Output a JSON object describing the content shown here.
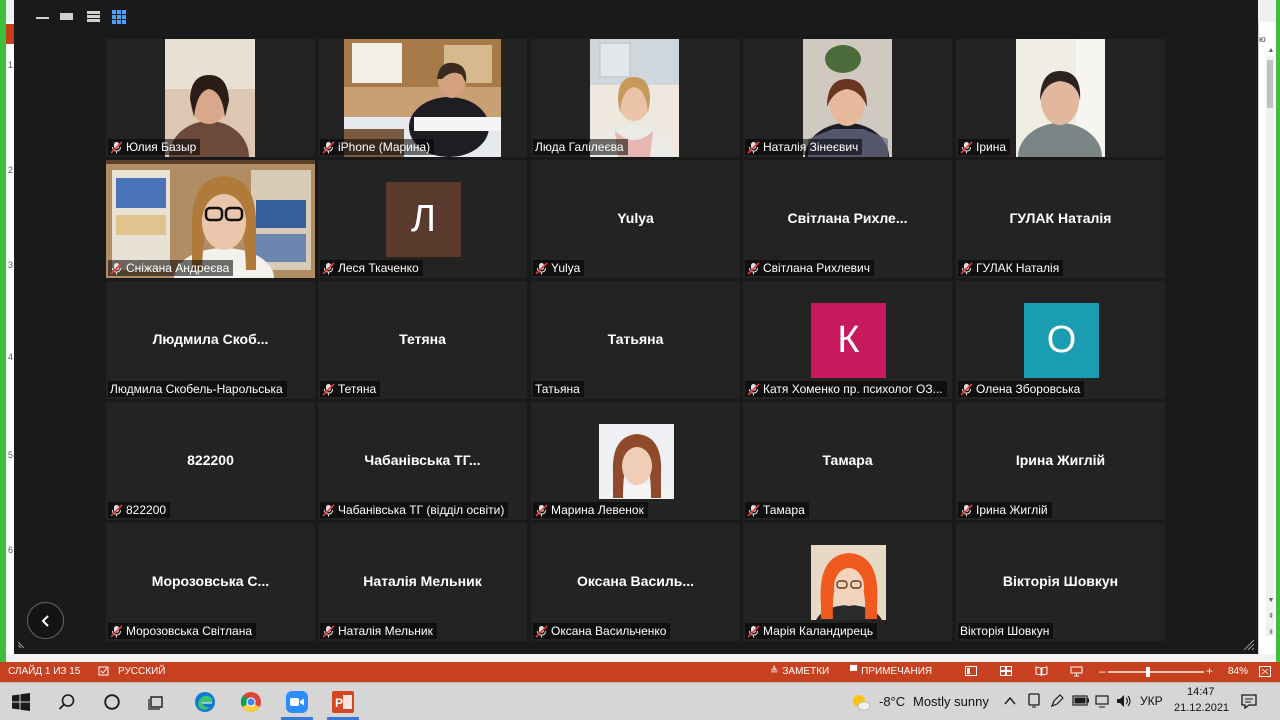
{
  "ppt": {
    "slide_numbers": [
      "1",
      "2",
      "3",
      "4",
      "5",
      "6"
    ],
    "right_edge_text": "ю",
    "status": {
      "slide_label": "СЛАЙД 1 ИЗ 15",
      "language": "РУССКИЙ",
      "notes": "ЗАМЕТКИ",
      "comments": "ПРИМЕЧАНИЯ",
      "zoom_minus": "–",
      "zoom_plus": "+",
      "zoom_level": "84%",
      "zoom_fraction": 0.4
    }
  },
  "zoom": {
    "grid": [
      {
        "name": "Юлия Базыр",
        "center": "",
        "muted": true,
        "kind": "photo",
        "photo": "woman-bob-dark"
      },
      {
        "name": "iPhone (Марина)",
        "center": "",
        "muted": true,
        "kind": "photo",
        "photo": "office"
      },
      {
        "name": "Люда Галілеєва",
        "center": "",
        "muted": false,
        "kind": "photo",
        "photo": "woman-scarf"
      },
      {
        "name": "Наталія Зінеєвич",
        "center": "",
        "muted": true,
        "kind": "photo",
        "photo": "woman-plant"
      },
      {
        "name": "Ірина",
        "center": "",
        "muted": true,
        "kind": "photo",
        "photo": "woman-light"
      },
      {
        "name": "Сніжана Андреєва",
        "center": "",
        "muted": true,
        "kind": "photo",
        "photo": "woman-glasses"
      },
      {
        "name": "Леся Ткаченко",
        "center": "",
        "muted": true,
        "kind": "avatar",
        "letter": "Л",
        "color": "#5b3a2e"
      },
      {
        "name": "Yulya",
        "center": "Yulya",
        "muted": true,
        "kind": "name"
      },
      {
        "name": "Світлана Рихлевич",
        "center": "Світлана  Рихле...",
        "muted": true,
        "kind": "name"
      },
      {
        "name": "ГУЛАК Наталія",
        "center": "ГУЛАК Наталія",
        "muted": true,
        "kind": "name"
      },
      {
        "name": "Людмила Скобель-Нарольська",
        "center": "Людмила  Скоб...",
        "muted": false,
        "kind": "name"
      },
      {
        "name": "Тетяна",
        "center": "Тетяна",
        "muted": true,
        "kind": "name"
      },
      {
        "name": "Татьяна",
        "center": "Татьяна",
        "muted": false,
        "kind": "name"
      },
      {
        "name": "Катя Хоменко пр. психолог ОЗ...",
        "center": "",
        "muted": true,
        "kind": "avatar",
        "letter": "К",
        "color": "#c8195f"
      },
      {
        "name": "Олена Зборовська",
        "center": "",
        "muted": true,
        "kind": "avatar",
        "letter": "О",
        "color": "#1a9db0"
      },
      {
        "name": "822200",
        "center": "822200",
        "muted": true,
        "kind": "name"
      },
      {
        "name": "Чабанівська ТГ (відділ освіти)",
        "center": "Чабанівська  ТГ...",
        "muted": true,
        "kind": "name"
      },
      {
        "name": "Марина Левенок",
        "center": "",
        "muted": true,
        "kind": "portrait",
        "photo": "redhead-light"
      },
      {
        "name": "Тамара",
        "center": "Тамара",
        "muted": true,
        "kind": "name"
      },
      {
        "name": "Ірина Жиглій",
        "center": "Ірина Жиглій",
        "muted": true,
        "kind": "name"
      },
      {
        "name": "Морозовська Світлана",
        "center": "Морозовська  С...",
        "muted": true,
        "kind": "name"
      },
      {
        "name": "Наталія Мельник",
        "center": "Наталія Мельник",
        "muted": true,
        "kind": "name"
      },
      {
        "name": "Оксана Васильченко",
        "center": "Оксана  Василь...",
        "muted": true,
        "kind": "name"
      },
      {
        "name": "Марія Каландирець",
        "center": "",
        "muted": true,
        "kind": "portrait",
        "photo": "redhead-bright"
      },
      {
        "name": "Вікторія Шовкун",
        "center": "Вікторія Шовкун",
        "muted": false,
        "kind": "name"
      }
    ]
  },
  "taskbar": {
    "apps": [
      "windows-start",
      "search",
      "cortana",
      "task-view",
      "edge",
      "chrome",
      "zoom",
      "powerpoint"
    ],
    "weather_temp": "-8°C",
    "weather_text": "Mostly sunny",
    "language": "УКР",
    "time": "14:47",
    "date": "21.12.2021"
  }
}
